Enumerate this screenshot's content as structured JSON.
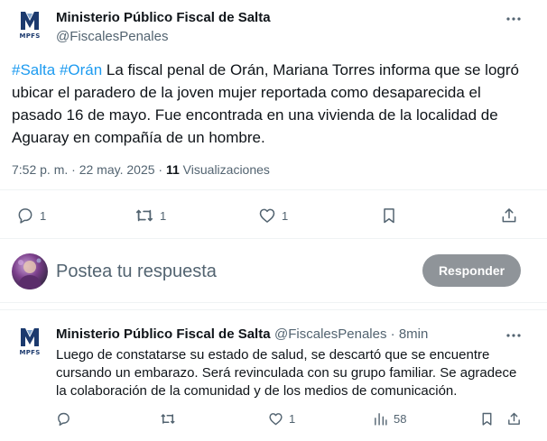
{
  "tweet": {
    "author_name": "Ministerio Público Fiscal de Salta",
    "author_handle": "@FiscalesPenales",
    "logo_text": "MPFS",
    "hashtag_1": "#Salta",
    "hashtag_2": "#Orán",
    "body": "La fiscal penal de Orán, Mariana Torres informa que se logró ubicar el paradero de la joven mujer reportada como desaparecida el pasado 16 de mayo. Fue encontrada en una vivienda de la localidad de Aguaray en compañía de un hombre.",
    "time": "7:52 p. m.",
    "separator": " · ",
    "date": "22 may. 2025",
    "views_count": "11",
    "views_label": "Visualizaciones",
    "actions": {
      "reply_count": "1",
      "retweet_count": "1",
      "like_count": "1"
    }
  },
  "composer": {
    "placeholder": "Postea tu respuesta",
    "button_label": "Responder"
  },
  "reply": {
    "author_name": "Ministerio Público Fiscal de Salta",
    "author_handle": "@FiscalesPenales",
    "separator": " · ",
    "time": "8min",
    "logo_text": "MPFS",
    "body": "Luego de constatarse su estado de salud, se descartó que se encuentre cursando un embarazo. Será revinculada con su grupo familiar. Se agradece la colaboración de la comunidad y de los medios de comunicación.",
    "actions": {
      "like_count": "1",
      "views_count": "58"
    }
  },
  "colors": {
    "accent": "#1d9bf0",
    "secondary_text": "#536471",
    "button_disabled": "#8f9499"
  },
  "icons": [
    "more-icon",
    "reply-icon",
    "retweet-icon",
    "like-icon",
    "bookmark-icon",
    "share-icon",
    "views-icon"
  ]
}
